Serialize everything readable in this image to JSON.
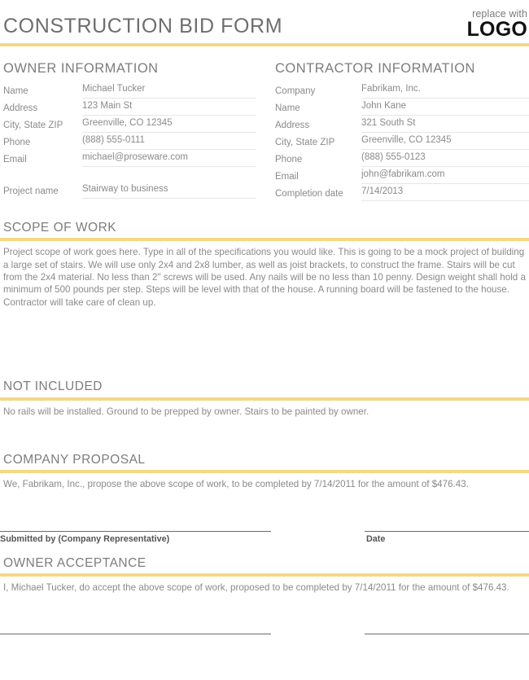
{
  "header": {
    "title": "CONSTRUCTION BID FORM",
    "logo_replace_text": "replace with",
    "logo_word": "LOGO"
  },
  "colors": {
    "accent": "#f5d785",
    "heading_gray": "#7d7d7d",
    "body_gray": "#8a8a8a",
    "rule_gray": "#e6e6e6",
    "signature_rule": "#6b6b6b",
    "logo_black": "#111111"
  },
  "owner_information": {
    "heading": "OWNER INFORMATION",
    "fields": [
      {
        "label": "Name",
        "value": "Michael Tucker"
      },
      {
        "label": "Address",
        "value": "123 Main St"
      },
      {
        "label": "City, State ZIP",
        "value": "Greenville, CO 12345"
      },
      {
        "label": "Phone",
        "value": "(888) 555-0111"
      },
      {
        "label": "Email",
        "value": "michael@proseware.com"
      }
    ],
    "project": {
      "label": "Project name",
      "value": "Stairway to business"
    }
  },
  "contractor_information": {
    "heading": "CONTRACTOR INFORMATION",
    "fields": [
      {
        "label": "Company",
        "value": "Fabrikam, Inc."
      },
      {
        "label": "Name",
        "value": "John Kane"
      },
      {
        "label": "Address",
        "value": "321 South St"
      },
      {
        "label": "City, State ZIP",
        "value": "Greenville, CO 12345"
      },
      {
        "label": "Phone",
        "value": "(888) 555-0123"
      },
      {
        "label": "Email",
        "value": "john@fabrikam.com"
      },
      {
        "label": "Completion date",
        "value": "7/14/2013"
      }
    ]
  },
  "scope_of_work": {
    "heading": "SCOPE OF WORK",
    "body": "Project scope of work goes here. Type in all of the specifications you would like. This is going to be a mock project of building a large set of stairs. We will use only 2x4 and 2x8 lumber, as well as joist brackets, to construct the frame. Stairs will be cut from the 2x4 material. No less than 2\" screws will be used.  Any nails will be no less than 10 penny. Design weight shall hold a minimum of 500 pounds per step. Steps will be level with that of the house. A running board will be fastened to the house. Contractor will take care of clean up."
  },
  "not_included": {
    "heading": "NOT INCLUDED",
    "body": "No rails will be installed. Ground to be prepped by owner. Stairs to be painted by owner."
  },
  "company_proposal": {
    "heading": "COMPANY PROPOSAL",
    "body": "We, Fabrikam, Inc., propose the above scope of work, to be completed by 7/14/2011 for the amount of $476.43."
  },
  "contractor_signature": {
    "submitted_by_label": "Submitted by (Company Representative)",
    "date_label": "Date"
  },
  "owner_acceptance": {
    "heading": "OWNER ACCEPTANCE",
    "body": "I, Michael Tucker, do accept the above scope of work, proposed to be completed by 7/14/2011 for the amount of $476.43."
  }
}
